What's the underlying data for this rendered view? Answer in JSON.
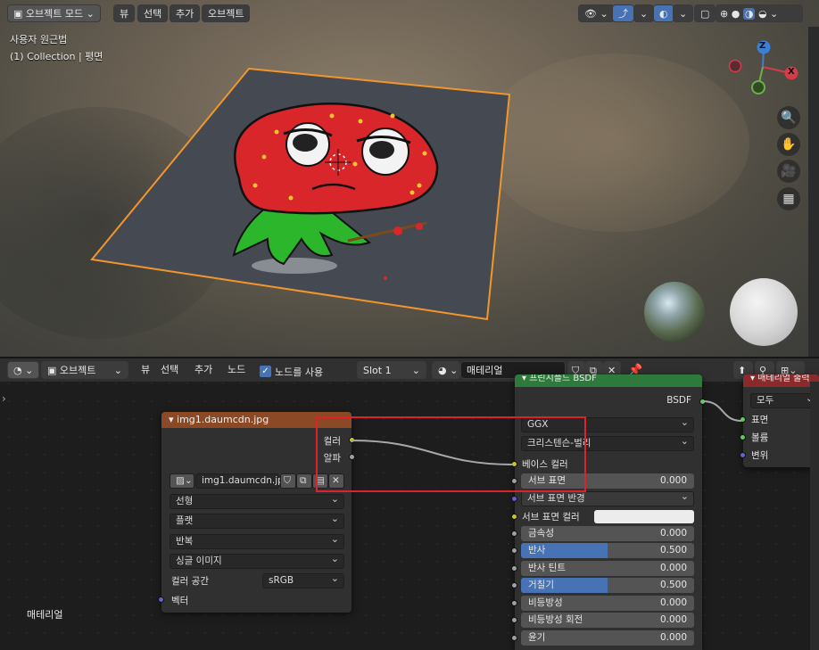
{
  "viewport": {
    "mode_label": "오브젝트 모드",
    "menu": [
      "뷰",
      "선택",
      "추가",
      "오브젝트"
    ],
    "info_line1": "사용자 원근법",
    "info_line2": "(1) Collection | 평면",
    "gizmo": {
      "z": "Z",
      "x": "X"
    }
  },
  "node_header": {
    "editor_label": "오브젝트",
    "menu": [
      "뷰",
      "선택",
      "추가",
      "노드"
    ],
    "use_nodes_label": "노드를 사용",
    "use_nodes_checked": true,
    "slot": "Slot 1",
    "material_name": "매테리얼"
  },
  "image_node": {
    "title": "img1.daumcdn.jpg",
    "outputs": [
      "컬러",
      "알파"
    ],
    "image_name": "img1.daumcdn.jpg",
    "interpolation": "선형",
    "projection": "플랫",
    "extension": "반복",
    "source": "싱글 이미지",
    "colorspace_label": "컬러 공간",
    "colorspace_value": "sRGB",
    "vector_label": "벡터"
  },
  "bsdf_node": {
    "title": "프린시플드 BSDF",
    "output": "BSDF",
    "distribution": "GGX",
    "subsurface_method": "크리스텐슨-벌리",
    "base_color_label": "베이스 컬러",
    "subsurface_radius_label": "서브 표면 반경",
    "subsurface_color_label": "서브 표면 컬러",
    "params": [
      {
        "label": "서브 표면",
        "value": "0.000",
        "fill": 0
      },
      {
        "label": "금속성",
        "value": "0.000",
        "fill": 0
      },
      {
        "label": "반사",
        "value": "0.500",
        "fill": 0.5
      },
      {
        "label": "반사 틴트",
        "value": "0.000",
        "fill": 0
      },
      {
        "label": "거칠기",
        "value": "0.500",
        "fill": 0.5
      },
      {
        "label": "비등방성",
        "value": "0.000",
        "fill": 0
      },
      {
        "label": "비등방성 회전",
        "value": "0.000",
        "fill": 0
      },
      {
        "label": "윤기",
        "value": "0.000",
        "fill": 0
      }
    ]
  },
  "output_node": {
    "title": "매테리얼 출력",
    "target": "모두",
    "inputs": [
      "표면",
      "볼륨",
      "변위"
    ]
  },
  "editor_label": "매테리얼",
  "colors": {
    "node_image_header": "#8b4a25",
    "node_shader_header": "#2e7a3a",
    "node_output_header": "#8a2a2a",
    "selection_outline": "#f2962c",
    "highlight_rect": "#e0202a",
    "slider_fill": "#4772b3"
  }
}
